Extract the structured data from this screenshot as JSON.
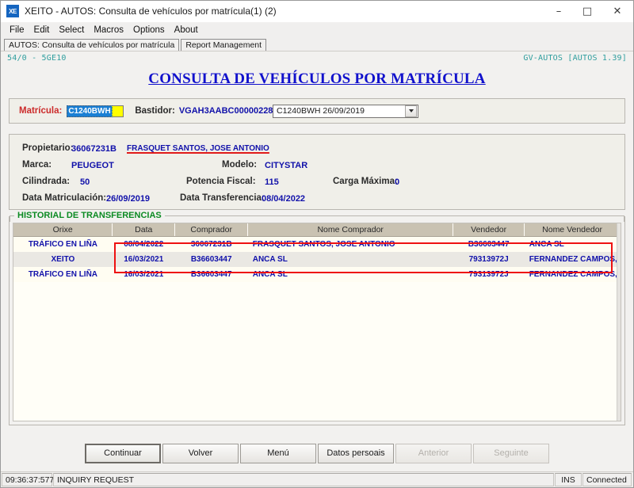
{
  "window": {
    "icon_label": "XE",
    "title": "XEITO - AUTOS: Consulta de vehículos por matrícula(1) (2)",
    "minimize": "–",
    "maximize": "□",
    "close": "✕"
  },
  "menubar": {
    "items": [
      {
        "label": "File"
      },
      {
        "label": "Edit"
      },
      {
        "label": "Select"
      },
      {
        "label": "Macros"
      },
      {
        "label": "Options"
      },
      {
        "label": "About"
      }
    ]
  },
  "tabs": [
    {
      "label": "AUTOS: Consulta de vehículos por matrícula",
      "active": true
    },
    {
      "label": "Report Management",
      "active": false
    }
  ],
  "screen": {
    "session_code": "54/0 - 5GE10",
    "app_version": "GV-AUTOS [AUTOS 1.39]",
    "title": "CONSULTA DE VEHÍCULOS POR MATRÍCULA"
  },
  "search": {
    "matricula_label": "Matrícula:",
    "matricula_value": "C1240BWH",
    "bastidor_label": "Bastidor:",
    "bastidor_value": "VGAH3AABC00000228",
    "combo_selected": "C1240BWH 26/09/2019"
  },
  "details": {
    "propietario_label": "Propietario:",
    "propietario_nif": "36067231B",
    "propietario_nome": "FRASQUET SANTOS, JOSE ANTONIO",
    "marca_label": "Marca:",
    "marca_value": "PEUGEOT",
    "modelo_label": "Modelo:",
    "modelo_value": "CITYSTAR",
    "cilindrada_label": "Cilindrada:",
    "cilindrada_value": "50",
    "potencia_label": "Potencia Fiscal:",
    "potencia_value": "115",
    "carga_label": "Carga Máxima:",
    "carga_value": "0",
    "data_matriculacion_label": "Data Matriculación:",
    "data_matriculacion_value": "26/09/2019",
    "data_transferencia_label": "Data Transferencia:",
    "data_transferencia_value": "08/04/2022"
  },
  "historial": {
    "legend": "HISTORIAL DE TRANSFERENCIAS",
    "columns": [
      "Orixe",
      "Data",
      "Comprador",
      "Nome Comprador",
      "Vendedor",
      "Nome Vendedor"
    ],
    "rows": [
      {
        "orixe": "TRÁFICO EN LIÑA",
        "data": "08/04/2022",
        "comprador": "36067231B",
        "nome_comprador": "FRASQUET SANTOS, JOSE ANTONIO",
        "vendedor": "B36603447",
        "nome_vendedor": "ANCA SL"
      },
      {
        "orixe": "XEITO",
        "data": "16/03/2021",
        "comprador": "B36603447",
        "nome_comprador": "ANCA SL",
        "vendedor": "79313972J",
        "nome_vendedor": "FERNANDEZ CAMPOS, ANGEL"
      },
      {
        "orixe": "TRÁFICO EN LIÑA",
        "data": "16/03/2021",
        "comprador": "B36603447",
        "nome_comprador": "ANCA SL",
        "vendedor": "79313972J",
        "nome_vendedor": "FERNANDEZ CAMPOS, ANGEL"
      }
    ],
    "highlight_color": "#ee1111"
  },
  "buttons": [
    {
      "label": "Continuar",
      "state": "default"
    },
    {
      "label": "Volver",
      "state": "normal"
    },
    {
      "label": "Menú",
      "state": "normal"
    },
    {
      "label": "Datos persoais",
      "state": "normal"
    },
    {
      "label": "Anterior",
      "state": "disabled"
    },
    {
      "label": "Seguinte",
      "state": "disabled"
    }
  ],
  "statusbar": {
    "time": "09:36:37:577",
    "message": "INQUIRY REQUEST",
    "ins": "INS",
    "connection": "Connected"
  }
}
